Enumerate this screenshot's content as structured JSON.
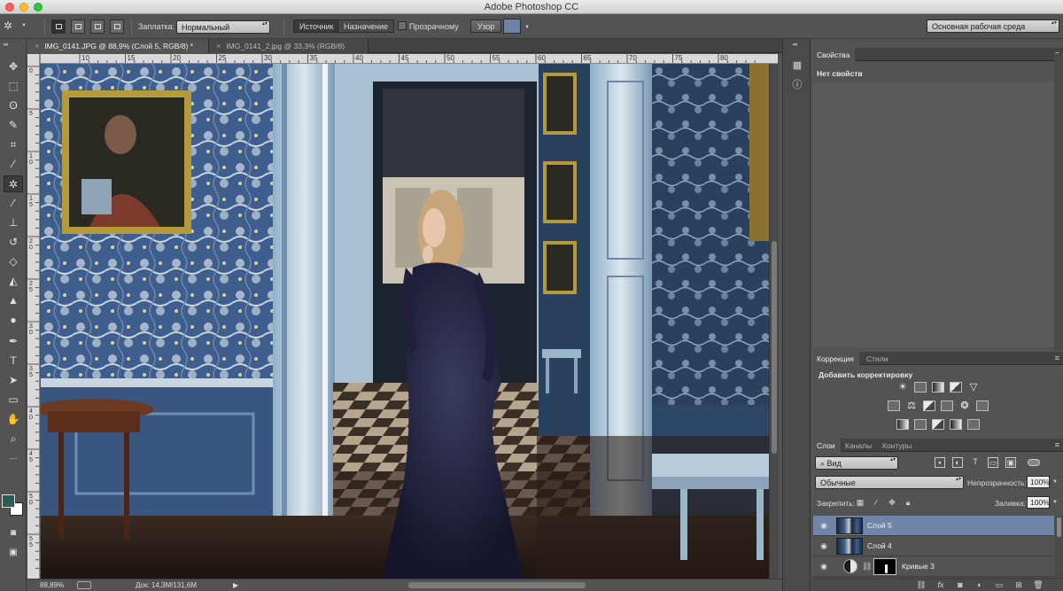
{
  "window": {
    "title": "Adobe Photoshop CC"
  },
  "options_bar": {
    "feather_label": "Заплатка:",
    "feather_mode": "Нормальный",
    "source_label": "Источник",
    "destination_label": "Назначение",
    "transparent_label": "Прозрачному",
    "pattern_label": "Узор",
    "workspace": "Основная рабочая среда"
  },
  "doc_tabs": [
    {
      "label": "IMG_0141.JPG @ 88,9% (Слой 5, RGB/8) *",
      "active": true
    },
    {
      "label": "IMG_0141_2.jpg @ 33,3% (RGB/8)",
      "active": false
    }
  ],
  "ruler": {
    "h_ticks": [
      "10",
      "15",
      "20",
      "25",
      "30",
      "35",
      "40",
      "45",
      "50",
      "55",
      "60",
      "65",
      "70",
      "75",
      "80"
    ],
    "v_ticks": [
      "0",
      "5",
      "1 0",
      "1 5",
      "2 0",
      "2 5",
      "3 0",
      "3 5",
      "4 0",
      "4 5",
      "5 0",
      "5 5"
    ]
  },
  "status_bar": {
    "zoom": "88,89%",
    "doc_info": "Док: 14,3M/131,6M"
  },
  "properties_panel": {
    "tab": "Свойства",
    "empty_text": "Нет свойств"
  },
  "adjustments_panel": {
    "tabs": [
      "Коррекция",
      "Стили"
    ],
    "title": "Добавить корректировку"
  },
  "layers_panel": {
    "tabs": [
      "Слои",
      "Каналы",
      "Контуры"
    ],
    "kind_filter": "Вид",
    "blend_mode": "Обычные",
    "opacity_label": "Непрозрачность:",
    "opacity_value": "100%",
    "lock_label": "Закрепить:",
    "fill_label": "Заливка:",
    "fill_value": "100%",
    "layers": [
      {
        "name": "Слой 5",
        "selected": true
      },
      {
        "name": "Слой 4",
        "selected": false
      },
      {
        "name": "Кривые 3",
        "selected": false
      }
    ]
  },
  "tool_icons": [
    "move-icon",
    "marquee-icon",
    "lasso-icon",
    "quick-selection-icon",
    "crop-icon",
    "eyedropper-icon",
    "patch-tool-icon",
    "brush-icon",
    "clone-stamp-icon",
    "history-brush-icon",
    "eraser-icon",
    "paint-bucket-icon",
    "blur-icon",
    "dodge-icon",
    "pen-icon",
    "type-icon",
    "path-selection-icon",
    "rectangle-icon",
    "hand-icon",
    "zoom-icon"
  ],
  "colors": {
    "foreground": "#2d5a5a",
    "background": "#ffffff",
    "layer_selected": "#6f86a8"
  }
}
